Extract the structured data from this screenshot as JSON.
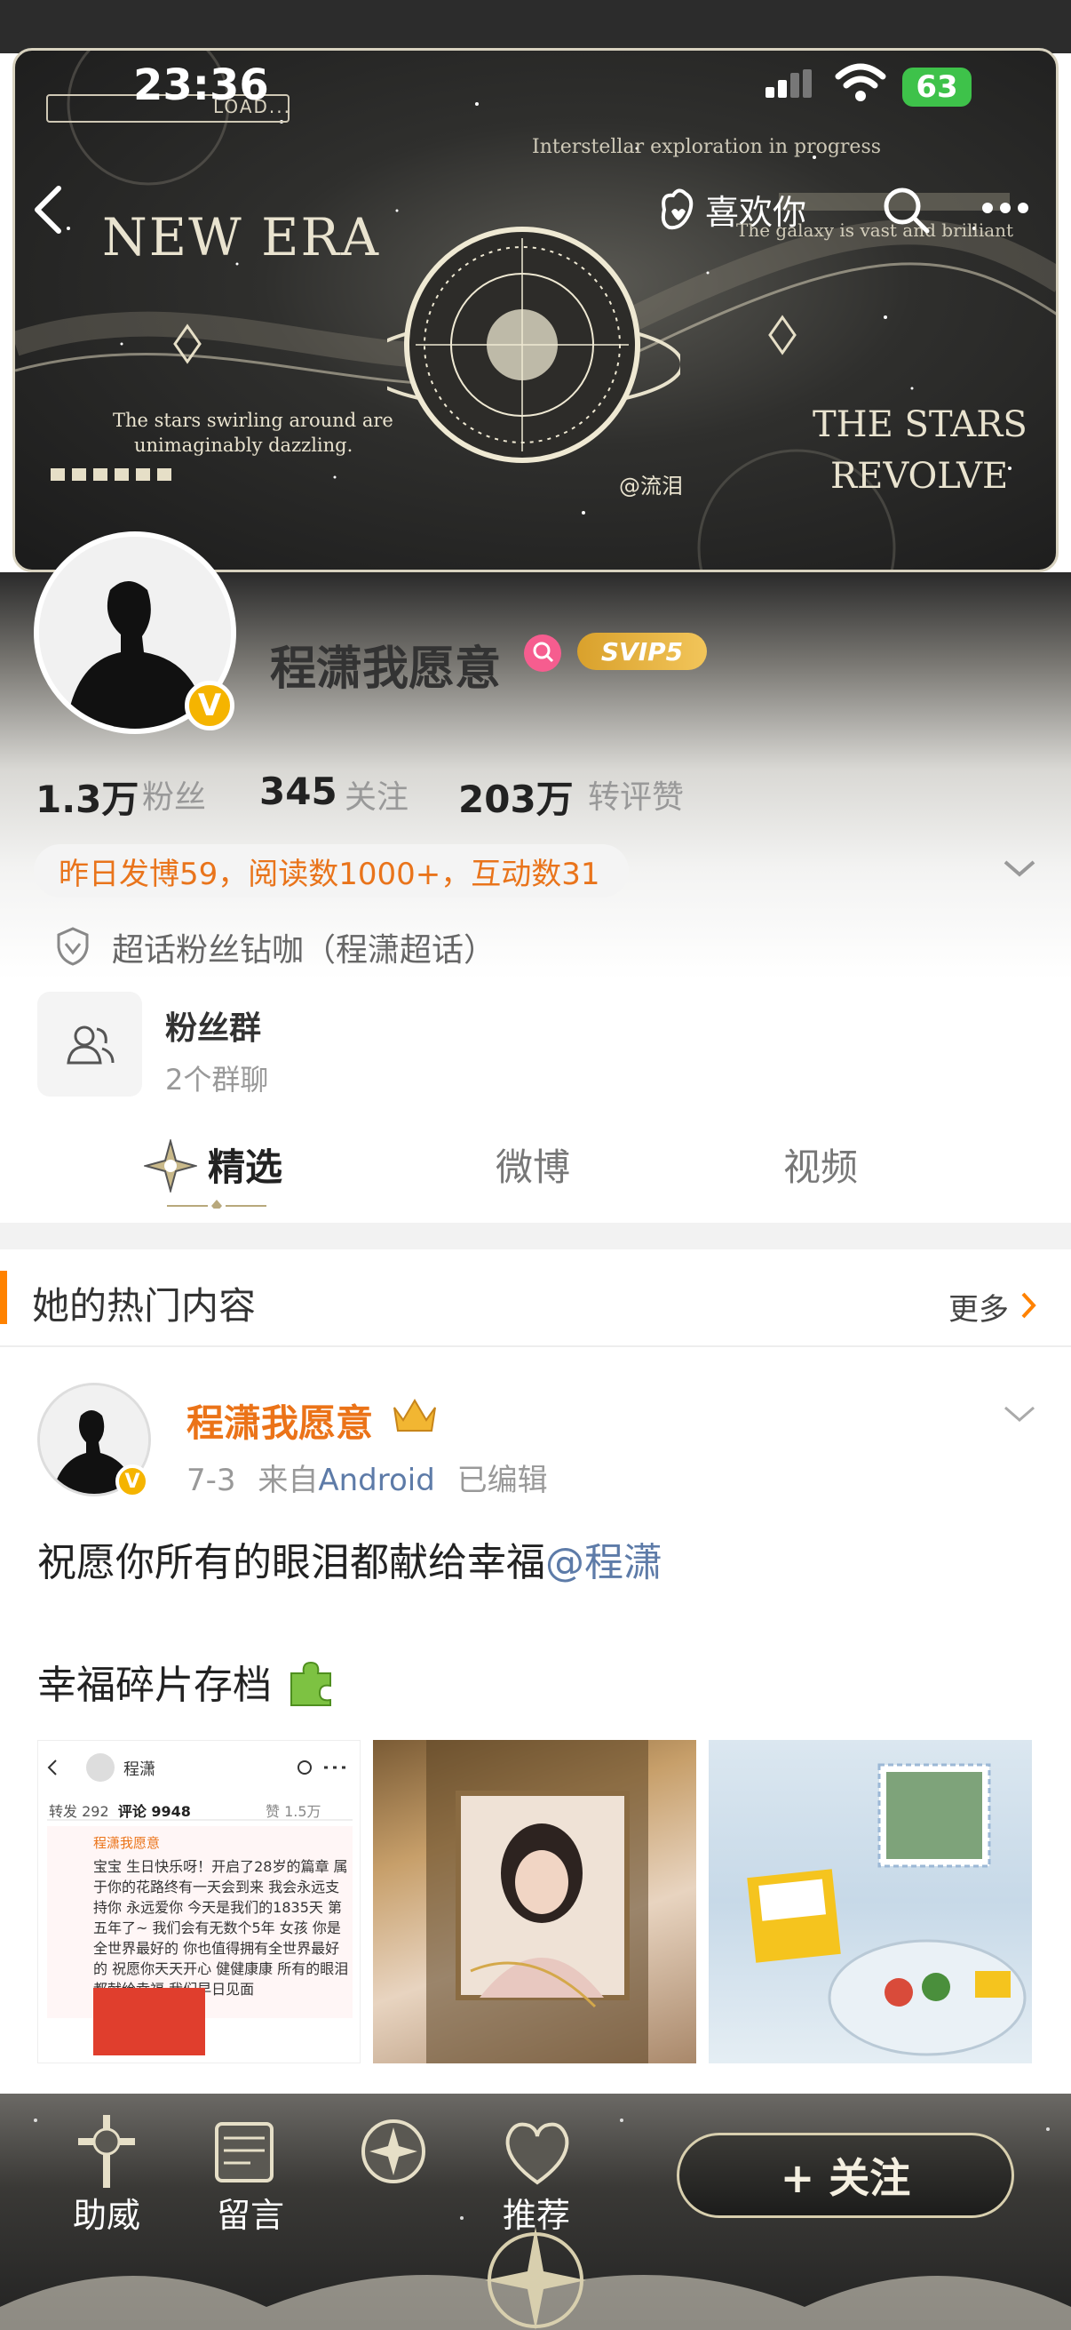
{
  "status_bar": {
    "time": "23:36",
    "load_text": "LOAD...",
    "battery": "63"
  },
  "banner": {
    "tagline_top": "Interstellar exploration in progress",
    "tagline_top2": "The galaxy is vast and brilliant",
    "title_left": "NEW ERA",
    "caption_left_1": "The stars swirling around are",
    "caption_left_2": "unimaginably dazzling.",
    "title_right_1": "THE STARS",
    "title_right_2": "REVOLVE",
    "signature": "@流泪"
  },
  "nav": {
    "like_label": "喜欢你"
  },
  "profile": {
    "username": "程潇我愿意",
    "svip_label": "SVIP5",
    "verified_mark": "V",
    "stats": {
      "fans_value": "1.3万",
      "fans_label": "粉丝",
      "following_value": "345",
      "following_label": "关注",
      "interactions_value": "203万",
      "interactions_label": "转评赞"
    },
    "summary": "昨日发博59，阅读数1000+，互动数31",
    "fan_tag": "超话粉丝钻咖（程潇超话）",
    "fan_group": {
      "title": "粉丝群",
      "subtitle": "2个群聊"
    }
  },
  "tabs": [
    {
      "label": "精选"
    },
    {
      "label": "微博"
    },
    {
      "label": "视频"
    }
  ],
  "hot_section": {
    "title": "她的热门内容",
    "more_label": "更多"
  },
  "post": {
    "author": "程潇我愿意",
    "date": "7-3",
    "source_prefix": "来自",
    "source": "Android",
    "edited": "已编辑",
    "line1": "祝愿你所有的眼泪都献给幸福",
    "mention": "@程潇",
    "line2": "幸福碎片存档",
    "thumb1": {
      "title": "程潇",
      "tab_repost": "转发 292",
      "tab_comment": "评论 9948",
      "likes": "赞 1.5万",
      "comment_author": "程潇我愿意",
      "comment_text": "宝宝 生日快乐呀！开启了28岁的篇章 属于你的花路终有一天会到来 我会永远支持你 永远爱你 今天是我们的1835天 第五年了~ 我们会有无数个5年 女孩 你是全世界最好的 你也值得拥有全世界最好的 祝愿你天天开心 健健康康 所有的眼泪都献给幸福 我们早日见面"
    }
  },
  "bottom_bar": {
    "items": [
      {
        "label": "助威"
      },
      {
        "label": "留言"
      },
      {
        "label": "推荐"
      }
    ],
    "follow_label": "+ 关注"
  },
  "colors": {
    "accent_orange": "#ff8200",
    "author_orange": "#eb7318",
    "link_blue": "#5d7ba8",
    "verified_gold": "#f5b400",
    "battery_green": "#3ec24a"
  }
}
